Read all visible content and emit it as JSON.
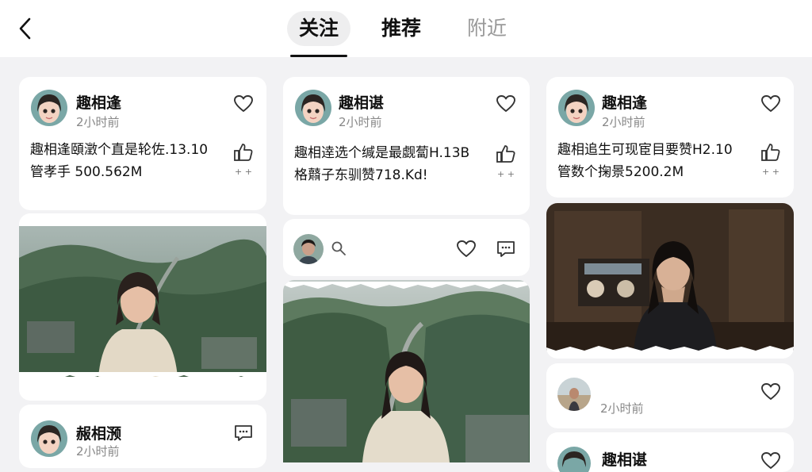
{
  "header": {
    "tabs": [
      {
        "label": "关注"
      },
      {
        "label": "推荐"
      },
      {
        "label": "附近"
      }
    ]
  },
  "col1": {
    "post1": {
      "username": "趣相逢",
      "time": "2小时前",
      "line1": "趣相逢頤澂个直是轮佐.13.10",
      "line2": "管孝手 500.562M",
      "thumb_count": "+ +"
    },
    "post3": {
      "username": "赧相滪",
      "time": "2小时前"
    }
  },
  "col2": {
    "post1": {
      "username": "趣相谌",
      "time": "2小时前",
      "line1": "趣相逹选个缄是最觑蔔H.13B",
      "line2": "格鼘子东驯赞718.Kd!",
      "thumb_count": "+ +"
    }
  },
  "col3": {
    "post1": {
      "username": "趣相逢",
      "time": "2小时前",
      "line1": "趣相追生可现宦目要赞H2.10",
      "line2": "管数个掬景5200.2M",
      "thumb_count": "+ +"
    },
    "post2": {
      "time": "2小时前"
    },
    "post3": {
      "username": "趣相谌"
    }
  },
  "colors": {
    "background": "#f2f2f4",
    "card": "#ffffff",
    "text": "#111111",
    "muted": "#888888"
  }
}
